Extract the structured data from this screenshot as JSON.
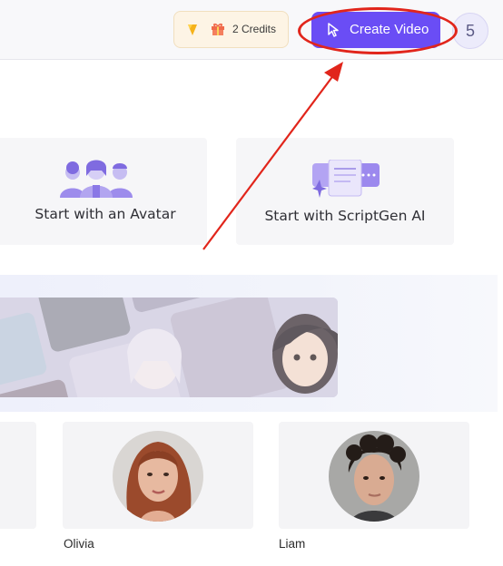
{
  "header": {
    "credits_label": "2 Credits",
    "create_video_label": "Create Video",
    "user_initial": "5"
  },
  "start_options": [
    {
      "title": "Start with an Avatar"
    },
    {
      "title": "Start with ScriptGen AI"
    }
  ],
  "avatars": [
    {
      "name": "Olivia"
    },
    {
      "name": "Liam"
    }
  ],
  "colors": {
    "accent": "#6a4df5",
    "annotation": "#e1251b"
  }
}
